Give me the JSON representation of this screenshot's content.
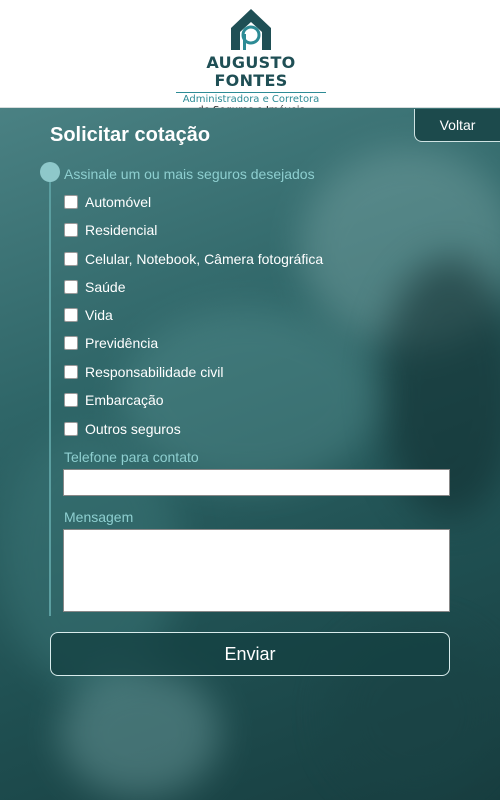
{
  "header": {
    "brand_name": "AUGUSTO FONTES",
    "brand_line1": "Administradora e Corretora",
    "brand_line2": "de Seguros e Imóveis"
  },
  "nav": {
    "back_label": "Voltar"
  },
  "form": {
    "title": "Solicitar cotação",
    "legend": "Assinale um ou mais seguros desejados",
    "options": [
      {
        "label": "Automóvel",
        "checked": false
      },
      {
        "label": "Residencial",
        "checked": false
      },
      {
        "label": "Celular, Notebook, Câmera fotográfica",
        "checked": false
      },
      {
        "label": "Saúde",
        "checked": false
      },
      {
        "label": "Vida",
        "checked": false
      },
      {
        "label": "Previdência",
        "checked": false
      },
      {
        "label": "Responsabilidade civil",
        "checked": false
      },
      {
        "label": "Embarcação",
        "checked": false
      },
      {
        "label": "Outros seguros",
        "checked": false
      }
    ],
    "phone_label": "Telefone para contato",
    "phone_value": "",
    "message_label": "Mensagem",
    "message_value": "",
    "submit_label": "Enviar"
  },
  "colors": {
    "brand_dark": "#1f4f55",
    "brand_accent": "#2d8b95",
    "label_teal": "#8ecfd0",
    "button_bg": "#1c4a4c"
  }
}
